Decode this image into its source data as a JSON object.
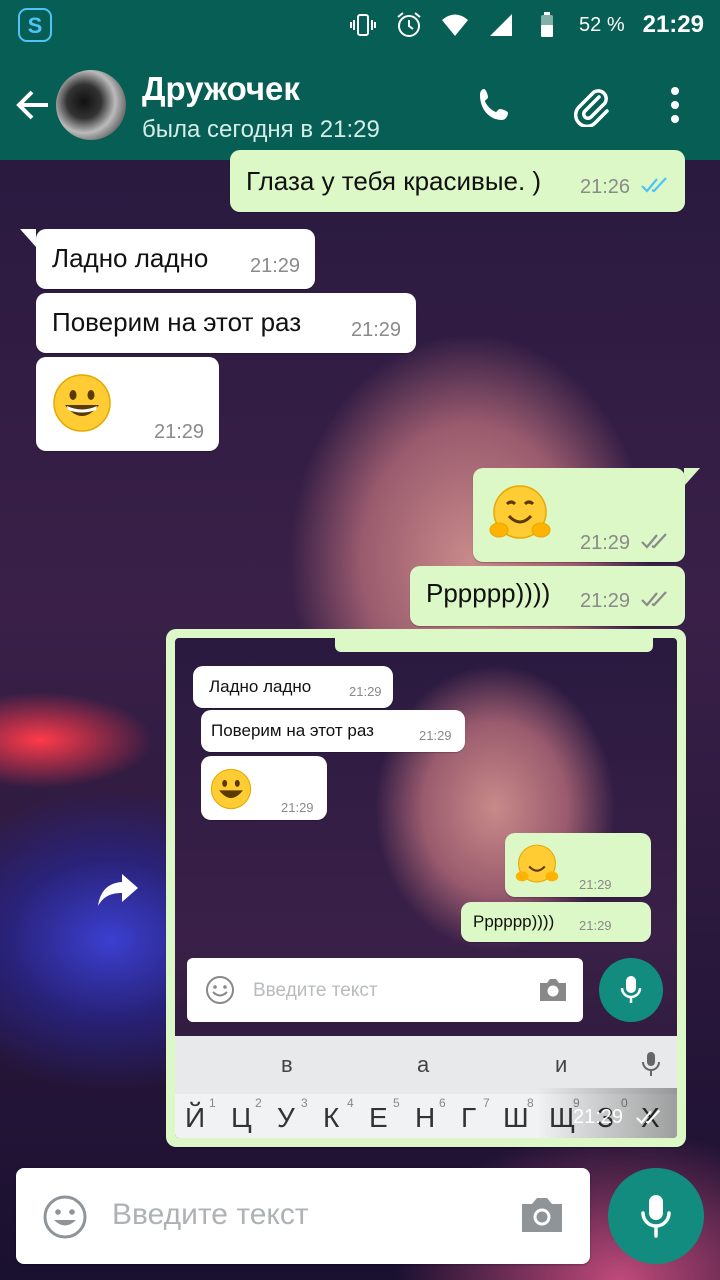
{
  "status_bar": {
    "battery": "52 %",
    "time": "21:29"
  },
  "header": {
    "contact_name": "Дружочек",
    "last_seen": "была сегодня в 21:29"
  },
  "messages": [
    {
      "dir": "out",
      "text": "Глаза у тебя красивые. )",
      "time": "21:26",
      "status": "read"
    },
    {
      "dir": "in",
      "text": "Ладно ладно",
      "time": "21:29"
    },
    {
      "dir": "in",
      "text": "Поверим на этот раз",
      "time": "21:29"
    },
    {
      "dir": "in",
      "text": "😀",
      "time": "21:29"
    },
    {
      "dir": "out",
      "text": "🤗",
      "time": "21:29",
      "status": "delivered"
    },
    {
      "dir": "out",
      "text": "Pppppp))))",
      "time": "21:29",
      "status": "delivered"
    },
    {
      "dir": "out",
      "type": "image",
      "time": "21:29",
      "status": "delivered"
    }
  ],
  "screenshot": {
    "messages": [
      {
        "dir": "in",
        "text": "Ладно ладно",
        "time": "21:29"
      },
      {
        "dir": "in",
        "text": "Поверим на этот раз",
        "time": "21:29"
      },
      {
        "dir": "in",
        "text": "😀",
        "time": "21:29"
      },
      {
        "dir": "out",
        "text": "🤗",
        "time": "21:29"
      },
      {
        "dir": "out",
        "text": "Pppppp))))",
        "time": "21:29"
      }
    ],
    "input_placeholder": "Введите текст",
    "suggestions": [
      "в",
      "а",
      "и"
    ],
    "keys": [
      "Й",
      "Ц",
      "У",
      "К",
      "Е",
      "Н",
      "Г",
      "Ш",
      "Щ",
      "З",
      "Х"
    ],
    "key_numbers": [
      "1",
      "2",
      "3",
      "4",
      "5",
      "6",
      "7",
      "8",
      "9",
      "0"
    ]
  },
  "input": {
    "placeholder": "Введите текст"
  }
}
